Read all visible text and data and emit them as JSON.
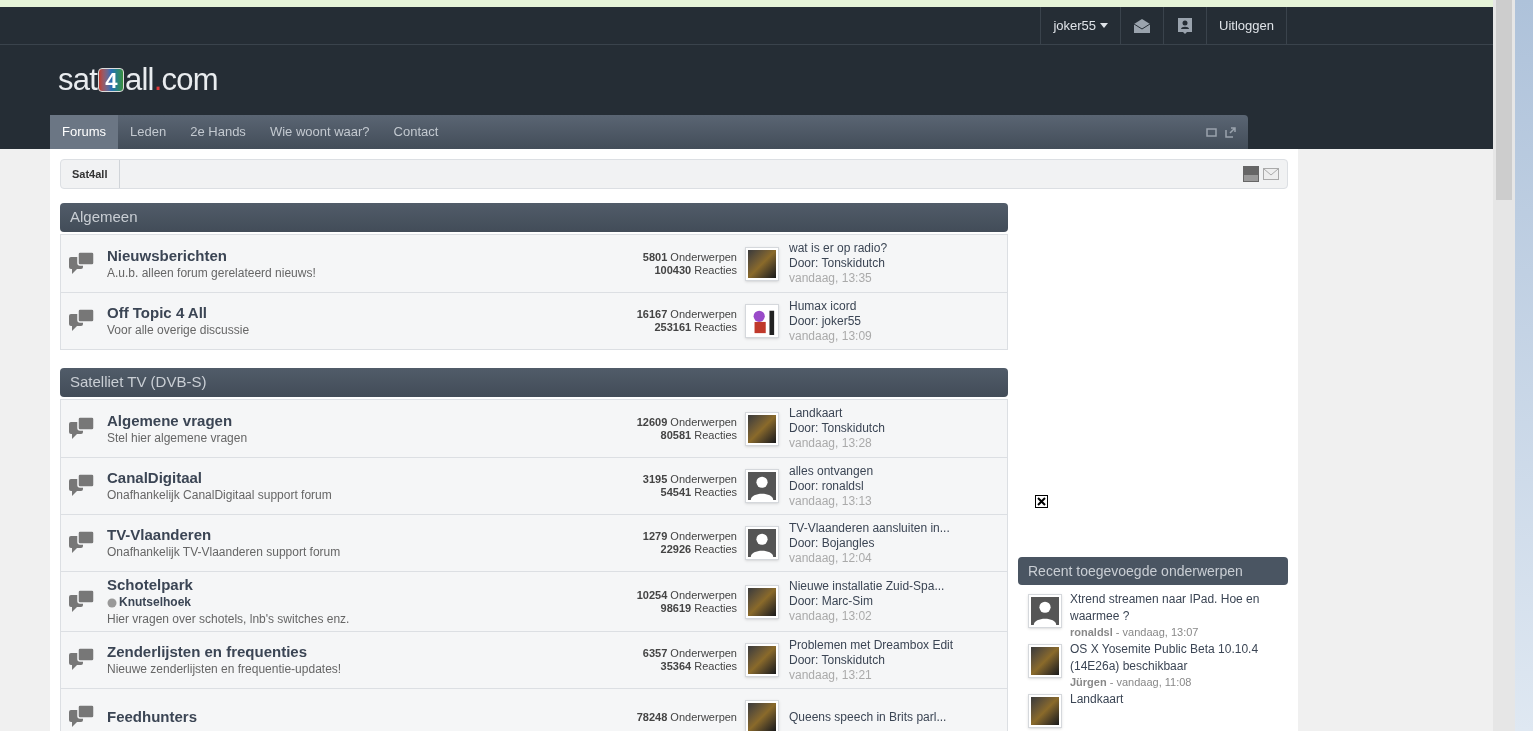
{
  "top_bar": {
    "username": "joker55",
    "logout": "Uitloggen"
  },
  "logo": {
    "before": "sat",
    "mark": "4",
    "after": "all",
    "dot": ".",
    "tld": "com"
  },
  "nav": {
    "tabs": [
      {
        "label": "Forums",
        "selected": true
      },
      {
        "label": "Leden",
        "selected": false
      },
      {
        "label": "2e Hands",
        "selected": false
      },
      {
        "label": "Wie woont waar?",
        "selected": false
      },
      {
        "label": "Contact",
        "selected": false
      }
    ]
  },
  "breadcrumb": [
    "Sat4all"
  ],
  "categories": [
    {
      "title": "Algemeen",
      "forums": [
        {
          "title": "Nieuwsberichten",
          "description": "A.u.b. alleen forum gerelateerd nieuws!",
          "topics": "**5801** Onderwerpen",
          "replies": "**100430** Reacties",
          "avatar": {
            "kind": "photo"
          },
          "last_title": "wat is er op radio?",
          "last_by": "Door: Tonskidutch",
          "last_time": "vandaag, 13:35"
        },
        {
          "title": "Off Topic 4 All",
          "description": "Voor alle overige discussie",
          "topics": "**16167** Onderwerpen",
          "replies": "**253161** Reacties",
          "avatar": {
            "kind": "cartoon"
          },
          "last_title": "Humax icord",
          "last_by": "Door: joker55",
          "last_time": "vandaag, 13:09"
        }
      ]
    },
    {
      "title": "Satelliet TV (DVB-S)",
      "forums": [
        {
          "title": "Algemene vragen",
          "description": "Stel hier algemene vragen",
          "topics": "**12609** Onderwerpen",
          "replies": "**80581** Reacties",
          "avatar": {
            "kind": "photo"
          },
          "last_title": "Landkaart",
          "last_by": "Door: Tonskidutch",
          "last_time": "vandaag, 13:28"
        },
        {
          "title": "CanalDigitaal",
          "description": "Onafhankelijk CanalDigitaal support forum",
          "topics": "**3195** Onderwerpen",
          "replies": "**54541** Reacties",
          "avatar": {
            "kind": "silhouette"
          },
          "last_title": "alles ontvangen",
          "last_by": "Door: ronaldsl",
          "last_time": "vandaag, 13:13"
        },
        {
          "title": "TV-Vlaanderen",
          "description": "Onafhankelijk TV-Vlaanderen support forum",
          "topics": "**1279** Onderwerpen",
          "replies": "**22926** Reacties",
          "avatar": {
            "kind": "silhouette"
          },
          "last_title": "TV-Vlaanderen aansluiten in...",
          "last_by": "Door: Bojangles",
          "last_time": "vandaag, 12:04"
        },
        {
          "title": "Schotelpark",
          "subforum": "Knutselhoek",
          "description": "Hier vragen over schotels, lnb's switches enz.",
          "topics": "**10254** Onderwerpen",
          "replies": "**98619** Reacties",
          "avatar": {
            "kind": "photo"
          },
          "last_title": "Nieuwe installatie Zuid-Spa...",
          "last_by": "Door: Marc-Sim",
          "last_time": "vandaag, 13:02"
        },
        {
          "title": "Zenderlijsten en frequenties",
          "description": "Nieuwe zenderlijsten en frequentie-updates!",
          "topics": "**6357** Onderwerpen",
          "replies": "**35364** Reacties",
          "avatar": {
            "kind": "photo"
          },
          "last_title": "Problemen met Dreambox Edit",
          "last_by": "Door: Tonskidutch",
          "last_time": "vandaag, 13:21"
        },
        {
          "title": "Feedhunters",
          "topics": "**78248** Onderwerpen",
          "avatar": {
            "kind": "photo"
          },
          "last_title": "Queens speech in Brits parl..."
        }
      ]
    }
  ],
  "sidebar": {
    "title": "Recent toegevoegde onderwerpen",
    "items": [
      {
        "avatar": {
          "kind": "silhouette"
        },
        "title": "Xtrend streamen naar IPad. Hoe en waarmee ?",
        "meta": "**ronaldsl** - vandaag, 13:07"
      },
      {
        "avatar": {
          "kind": "photo"
        },
        "title": "OS X Yosemite Public Beta 10.10.4 (14E26a) beschikbaar",
        "meta": "**Jürgen** - vandaag, 11:08"
      },
      {
        "avatar": {
          "kind": "photo"
        },
        "title": "Landkaart"
      }
    ]
  }
}
